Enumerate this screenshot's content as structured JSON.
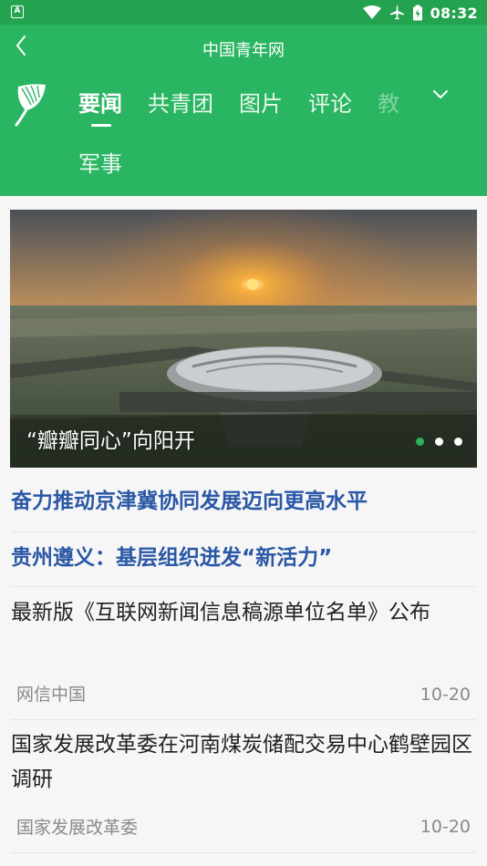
{
  "status_bar": {
    "notification_icon_letter": "A",
    "time": "08:32",
    "icons": [
      "wifi-icon",
      "airplane-icon",
      "battery-icon"
    ]
  },
  "header": {
    "title": "中国青年网",
    "back_icon": "chevron-left-icon",
    "expand_icon": "chevron-down-icon",
    "tabs": [
      {
        "label": "要闻",
        "active": true
      },
      {
        "label": "共青团",
        "active": false
      },
      {
        "label": "图片",
        "active": false
      },
      {
        "label": "评论",
        "active": false
      },
      {
        "label": "教",
        "active": false
      }
    ],
    "second_row_tab": "军事"
  },
  "banner": {
    "caption": "“瓣瓣同心”向阳开",
    "slide_count": 3,
    "active_slide": 1
  },
  "headlines": [
    "奋力推动京津冀协同发展迈向更高水平",
    "贵州遵义：基层组织迸发“新活力”"
  ],
  "news": [
    {
      "title": "最新版《互联网新闻信息稿源单位名单》公布",
      "source": "网信中国",
      "date": "10-20"
    },
    {
      "title": "国家发展改革委在河南煤炭储配交易中心鹤壁园区调研",
      "source": "国家发展改革委",
      "date": "10-20"
    }
  ],
  "colors": {
    "header": "#29b561",
    "status_bar": "#23a24f",
    "headline": "#2a58a6",
    "dot_active": "#2cb35d"
  }
}
